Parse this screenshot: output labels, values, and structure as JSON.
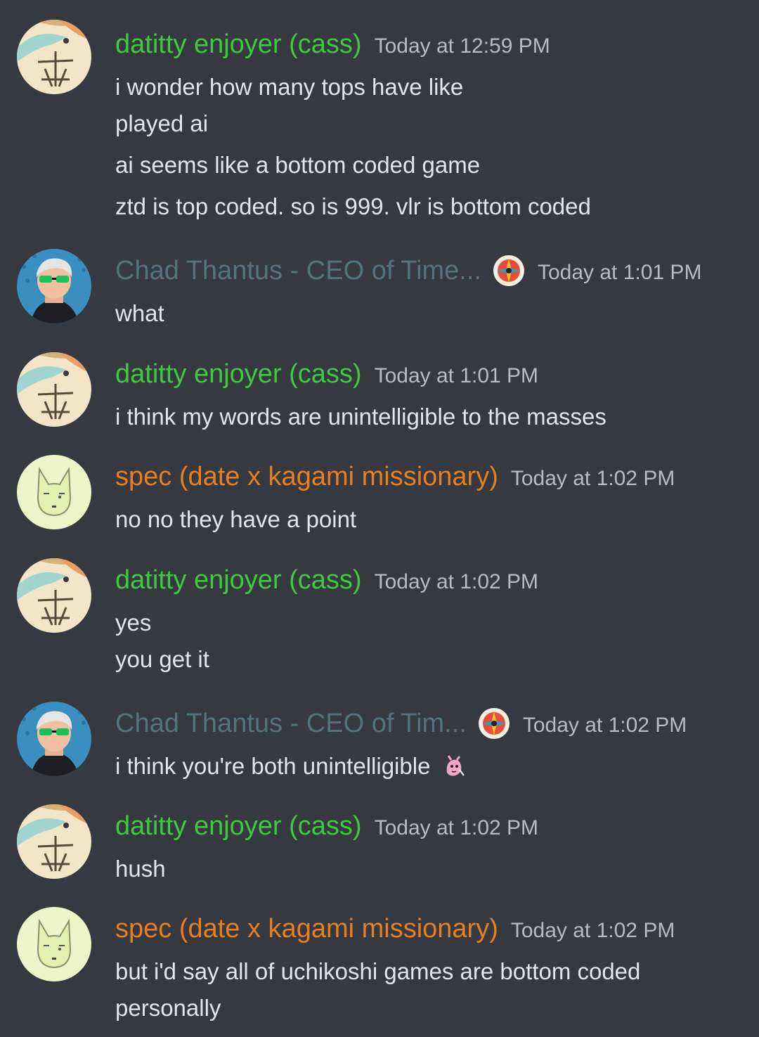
{
  "colors": {
    "background": "#36393f",
    "cass": "#3ec93e",
    "chad": "#55727f",
    "spec": "#e67e22",
    "timestamp": "#b9bbbe",
    "text": "#e3e5e8"
  },
  "messages": [
    {
      "author": "datitty enjoyer (cass)",
      "timestamp": "Today at 12:59 PM",
      "avatar": "dragon-avatar",
      "lines": [
        "i wonder how many tops have like",
        "played ai",
        "ai seems like a bottom coded game",
        "ztd is top coded. so is 999. vlr is bottom coded"
      ]
    },
    {
      "author": "Chad Thantus - CEO of Time...",
      "timestamp": "Today at 1:01 PM",
      "avatar": "sunglasses-man-avatar",
      "role_icon": "compass-badge-icon",
      "lines": [
        "what"
      ]
    },
    {
      "author": "datitty enjoyer (cass)",
      "timestamp": "Today at 1:01 PM",
      "avatar": "dragon-avatar",
      "lines": [
        "i think my words are unintelligible to the masses"
      ]
    },
    {
      "author": "spec (date x kagami missionary)",
      "timestamp": "Today at 1:02 PM",
      "avatar": "cat-face-avatar",
      "lines": [
        "no no they have a point"
      ]
    },
    {
      "author": "datitty enjoyer (cass)",
      "timestamp": "Today at 1:02 PM",
      "avatar": "dragon-avatar",
      "lines": [
        "yes",
        "you get it"
      ]
    },
    {
      "author": "Chad Thantus - CEO of Tim...",
      "timestamp": "Today at 1:02 PM",
      "avatar": "sunglasses-man-avatar",
      "role_icon": "compass-badge-icon",
      "lines": [
        "i think you're both unintelligible"
      ],
      "emoji": "pink-creature-emoji-icon"
    },
    {
      "author": "datitty enjoyer (cass)",
      "timestamp": "Today at 1:02 PM",
      "avatar": "dragon-avatar",
      "lines": [
        "hush"
      ]
    },
    {
      "author": "spec (date x kagami missionary)",
      "timestamp": "Today at 1:02 PM",
      "avatar": "cat-face-avatar",
      "lines": [
        "but i'd say all of uchikoshi games are bottom coded",
        "personally"
      ]
    }
  ]
}
